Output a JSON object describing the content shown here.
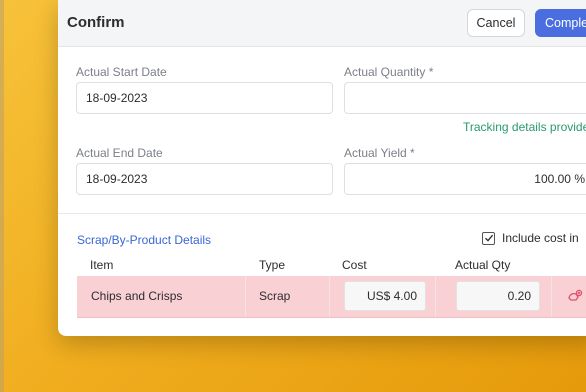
{
  "dialog": {
    "title": "Confirm",
    "cancel_label": "Cancel",
    "complete_label": "Complete"
  },
  "form": {
    "actual_start_date": {
      "label": "Actual Start Date",
      "value": "18-09-2023"
    },
    "actual_quantity": {
      "label": "Actual Quantity *",
      "value": ""
    },
    "tracking_hint": "Tracking details provided",
    "actual_end_date": {
      "label": "Actual End Date",
      "value": "18-09-2023"
    },
    "actual_yield": {
      "label": "Actual Yield *",
      "value": "100.00 %"
    }
  },
  "scrap_section": {
    "title": "Scrap/By-Product Details",
    "include_cost_label": "Include cost in",
    "include_cost_checked": true,
    "columns": [
      "Item",
      "Type",
      "Cost",
      "Actual Qty"
    ],
    "rows": [
      {
        "item": "Chips and Crisps",
        "type": "Scrap",
        "cost": "US$ 4.00",
        "actual_qty": "0.20"
      }
    ]
  },
  "colors": {
    "primary": "#4a6ee0",
    "row_highlight": "#f9d0d4",
    "hint": "#2a9a6e",
    "background": "#f0ad1e"
  }
}
